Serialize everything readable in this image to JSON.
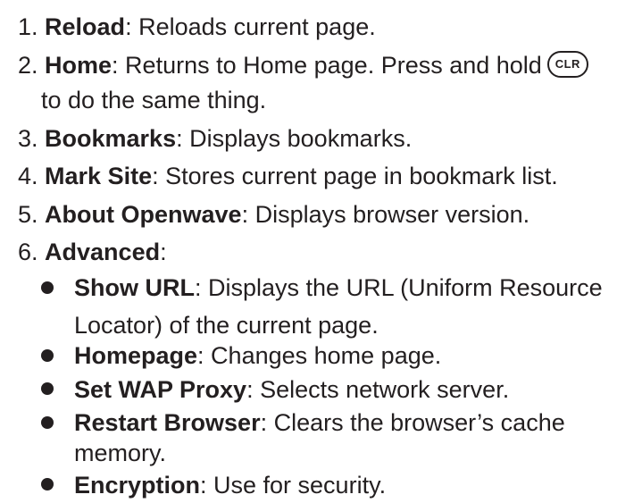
{
  "items": [
    {
      "num": "1. ",
      "term": "Reload",
      "desc": ": Reloads current page."
    },
    {
      "num": "2. ",
      "term": "Home",
      "desc": ": Returns to Home page. Press and hold",
      "key": "CLR",
      "cont": "to do the same thing."
    },
    {
      "num": "3. ",
      "term": "Bookmarks",
      "desc": ": Displays bookmarks."
    },
    {
      "num": "4. ",
      "term": "Mark Site",
      "desc": ": Stores current page in bookmark list."
    },
    {
      "num": "5. ",
      "term": "About Openwave",
      "desc": ": Displays browser version."
    },
    {
      "num": "6. ",
      "term": "Advanced",
      "desc": ":"
    }
  ],
  "subitems": [
    {
      "term": "Show URL",
      "desc": ": Displays the URL (Uniform Resource",
      "cont": "Locator) of the current page."
    },
    {
      "term": "Homepage",
      "desc": ": Changes home page."
    },
    {
      "term": "Set WAP Proxy",
      "desc": ": Selects network server."
    },
    {
      "term": "Restart Browser",
      "desc": ": Clears the browser’s cache",
      "cont": "memory."
    },
    {
      "term": "Encryption",
      "desc": ": Use for security."
    }
  ]
}
